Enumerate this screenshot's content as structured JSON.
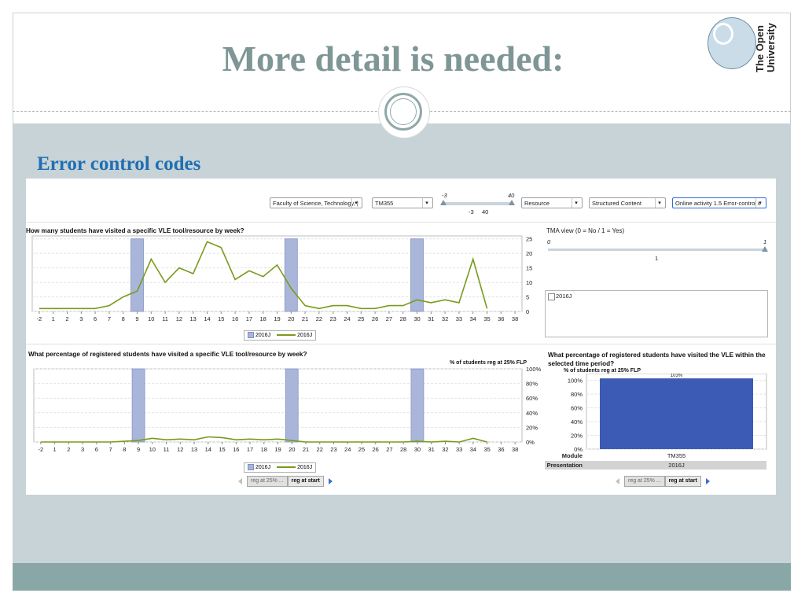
{
  "slide": {
    "title": "More detail is needed:",
    "section": "Error control codes",
    "logo_line1": "The Open",
    "logo_line2": "University"
  },
  "filters": {
    "faculty": "Faculty of Science, Technology, |",
    "module": "TM355",
    "resource": "Resource",
    "content": "Structured Content",
    "activity": "Online activity 1.5 Error-control c"
  },
  "week_slider": {
    "min_label": "-3",
    "max_label": "40",
    "sel_min": "-3",
    "sel_max": "40"
  },
  "tma_view": {
    "label": "TMA view (0 = No / 1 = Yes)",
    "min_label": "0",
    "max_label": "1",
    "value": "1"
  },
  "presentation_list": {
    "item": "2016J",
    "checked": false
  },
  "colors": {
    "bar": "#aab6d9",
    "line": "#7a9a1c",
    "column": "#3b5bb5"
  },
  "chart_data": [
    {
      "type": "line",
      "title": "How many students have visited a specific VLE tool/resource by week?",
      "categories": [
        "-2",
        "1",
        "2",
        "3",
        "6",
        "7",
        "8",
        "9",
        "10",
        "11",
        "12",
        "13",
        "14",
        "15",
        "16",
        "17",
        "18",
        "19",
        "20",
        "21",
        "22",
        "23",
        "24",
        "25",
        "26",
        "27",
        "28",
        "30",
        "31",
        "32",
        "33",
        "34",
        "35",
        "36",
        "38"
      ],
      "series": [
        {
          "name": "2016J",
          "type": "bar",
          "categories": [
            "9",
            "20",
            "30"
          ],
          "values": [
            25,
            25,
            25
          ]
        },
        {
          "name": "2016J",
          "type": "line",
          "values": [
            1,
            1,
            1,
            1,
            1,
            2,
            5,
            7,
            18,
            10,
            15,
            13,
            24,
            22,
            11,
            14,
            12,
            16,
            8,
            2,
            1,
            2,
            2,
            1,
            1,
            2,
            2,
            4,
            3,
            4,
            3,
            18,
            1
          ]
        }
      ],
      "yticks": [
        "0",
        "5",
        "10",
        "15",
        "20",
        "25"
      ],
      "ylim": [
        0,
        26
      ],
      "legend": [
        "2016J",
        "2016J"
      ]
    },
    {
      "type": "line",
      "title": "What percentage of registered students have visited a specific VLE tool/resource by week?",
      "ylabel": "% of students reg at 25% FLP",
      "categories": [
        "-2",
        "1",
        "2",
        "3",
        "6",
        "7",
        "8",
        "9",
        "10",
        "11",
        "12",
        "13",
        "14",
        "15",
        "16",
        "17",
        "18",
        "19",
        "20",
        "21",
        "22",
        "23",
        "24",
        "25",
        "26",
        "27",
        "28",
        "30",
        "31",
        "32",
        "33",
        "34",
        "35",
        "36",
        "38"
      ],
      "series": [
        {
          "name": "2016J",
          "type": "bar",
          "categories": [
            "9",
            "20",
            "30"
          ],
          "values": [
            100,
            100,
            100
          ]
        },
        {
          "name": "2016J",
          "type": "line",
          "values": [
            0,
            0,
            0,
            0,
            0,
            0,
            1,
            2,
            5,
            3,
            4,
            3,
            7,
            6,
            3,
            4,
            3,
            4,
            2,
            0,
            0,
            0,
            0,
            0,
            0,
            0,
            0,
            1,
            0,
            1,
            0,
            5,
            0
          ]
        }
      ],
      "yticks": [
        "0%",
        "20%",
        "40%",
        "60%",
        "80%",
        "100%"
      ],
      "ylim": [
        0,
        100
      ],
      "legend": [
        "2016J",
        "2016J"
      ]
    },
    {
      "type": "bar",
      "title": "What percentage of registered students have visited the VLE within the selected time period?",
      "ylabel": "% of students reg at 25% FLP",
      "categories": [
        "TM355"
      ],
      "values": [
        103
      ],
      "value_label": "103%",
      "yticks": [
        "0%",
        "20%",
        "40%",
        "60%",
        "80%",
        "100%"
      ],
      "ylim": [
        0,
        110
      ],
      "row_labels": {
        "module": "Module",
        "module_value": "TM355",
        "presentation": "Presentation",
        "presentation_value": "2016J"
      }
    }
  ],
  "pager": {
    "prev_label": "reg at 25% ...",
    "current_label": "reg at start"
  }
}
